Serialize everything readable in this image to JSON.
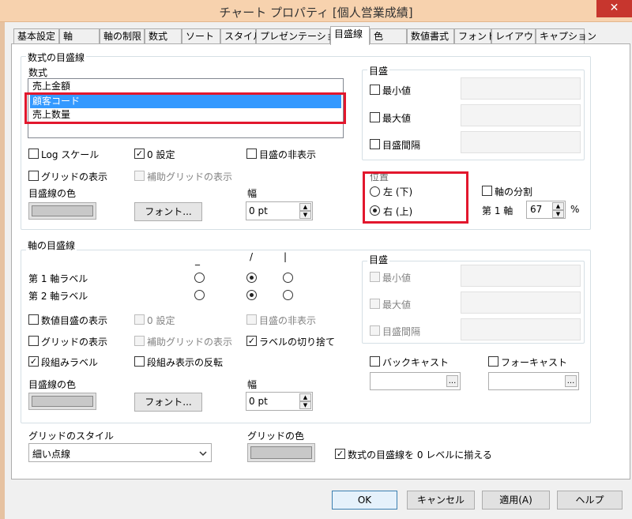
{
  "window": {
    "title": "チャート プロパティ [個人営業成績]",
    "close_glyph": "✕"
  },
  "tabs": [
    "基本設定",
    "軸",
    "軸の制限",
    "数式",
    "ソート",
    "スタイル",
    "プレゼンテーション",
    "目盛線",
    "色",
    "数値書式",
    "フォント",
    "レイアウト",
    "キャプション"
  ],
  "active_tab": "目盛線",
  "formula_grid": {
    "title": "数式の目盛線",
    "list_label": "数式",
    "items": [
      "売上金額",
      "顧客コード",
      "売上数量"
    ],
    "selected": [
      "顧客コード"
    ],
    "log_scale": {
      "label": "Log スケール",
      "checked": false
    },
    "zero_setting": {
      "label": "0 設定",
      "checked": true
    },
    "hide_ticks": {
      "label": "目盛の非表示",
      "checked": false
    },
    "show_grid": {
      "label": "グリッドの表示",
      "checked": false
    },
    "show_aux_grid": {
      "label": "補助グリッドの表示",
      "checked": false,
      "disabled": true
    },
    "line_color_label": "目盛線の色",
    "font_button": "フォント...",
    "width_label": "幅",
    "width_value": "0 pt",
    "ticks": {
      "title": "目盛",
      "min_label": "最小値",
      "max_label": "最大値",
      "interval_label": "目盛間隔"
    },
    "position": {
      "title": "位置",
      "left_label": "左 (下)",
      "right_label": "右 (上)",
      "selected": "右 (上)"
    },
    "axis_split": {
      "label": "軸の分割",
      "checked": false
    },
    "axis1_label": "第 1 軸",
    "axis1_value": "67",
    "percent": "%"
  },
  "axis_grid": {
    "title": "軸の目盛線",
    "col_headers": [
      "_",
      "/",
      "|"
    ],
    "rows": [
      {
        "label": "第 1 軸ラベル",
        "selected_col": 1
      },
      {
        "label": "第 2 軸ラベル",
        "selected_col": 1
      }
    ],
    "show_value_ticks": {
      "label": "数値目盛の表示",
      "checked": false
    },
    "zero_setting": {
      "label": "0 設定",
      "checked": false,
      "disabled": true
    },
    "hide_ticks": {
      "label": "目盛の非表示",
      "checked": false,
      "disabled": true
    },
    "show_grid": {
      "label": "グリッドの表示",
      "checked": false
    },
    "show_aux_grid": {
      "label": "補助グリッドの表示",
      "checked": false,
      "disabled": true
    },
    "truncate_labels": {
      "label": "ラベルの切り捨て",
      "checked": true
    },
    "stacked_labels": {
      "label": "段組みラベル",
      "checked": true
    },
    "reverse_stacked": {
      "label": "段組み表示の反転",
      "checked": false
    },
    "line_color_label": "目盛線の色",
    "font_button": "フォント...",
    "width_label": "幅",
    "width_value": "0 pt",
    "ticks": {
      "title": "目盛",
      "min_label": "最小値",
      "max_label": "最大値",
      "interval_label": "目盛間隔"
    },
    "backcast": {
      "label": "バックキャスト",
      "checked": false
    },
    "forecast": {
      "label": "フォーキャスト",
      "checked": false
    },
    "dots": "..."
  },
  "grid_style": {
    "label": "グリッドのスタイル",
    "value": "細い点線",
    "color_label": "グリッドの色",
    "align_zero": {
      "label": "数式の目盛線を 0 レベルに揃える",
      "checked": true
    }
  },
  "footer": {
    "ok": "OK",
    "cancel": "キャンセル",
    "apply": "適用(A)",
    "help": "ヘルプ"
  },
  "colors": {
    "highlight": "#e2172d",
    "selection": "#3399ff",
    "title_bar": "#f7d2ae"
  }
}
